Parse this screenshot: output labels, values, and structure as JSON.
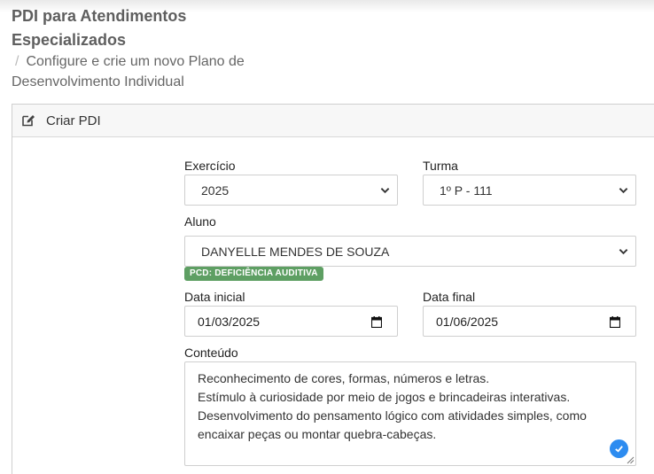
{
  "header": {
    "title": "PDI para Atendimentos Especializados",
    "breadcrumb_sep": "/",
    "breadcrumb": "Configure e crie um novo Plano de Desenvolvimento Individual"
  },
  "card": {
    "title": "Criar PDI",
    "icon": "edit-icon"
  },
  "form": {
    "exercicio": {
      "label": "Exercício",
      "value": "2025"
    },
    "turma": {
      "label": "Turma",
      "value": "1º P - 111"
    },
    "aluno": {
      "label": "Aluno",
      "value": "DANYELLE MENDES DE SOUZA",
      "badge": "PCD: DEFICIÊNCIA AUDITIVA"
    },
    "data_inicial": {
      "label": "Data inicial",
      "value": "01/03/2025"
    },
    "data_final": {
      "label": "Data final",
      "value": "01/06/2025"
    },
    "conteudo": {
      "label": "Conteúdo",
      "lines": [
        "Reconhecimento de cores, formas, números e letras.",
        "Estímulo à curiosidade por meio de jogos e brincadeiras interativas.",
        "Desenvolvimento do pensamento lógico com atividades simples, como",
        "encaixar peças ou montar quebra-cabeças."
      ]
    }
  },
  "colors": {
    "badge_bg": "#5e9f63",
    "check_badge": "#2d8cf0"
  }
}
